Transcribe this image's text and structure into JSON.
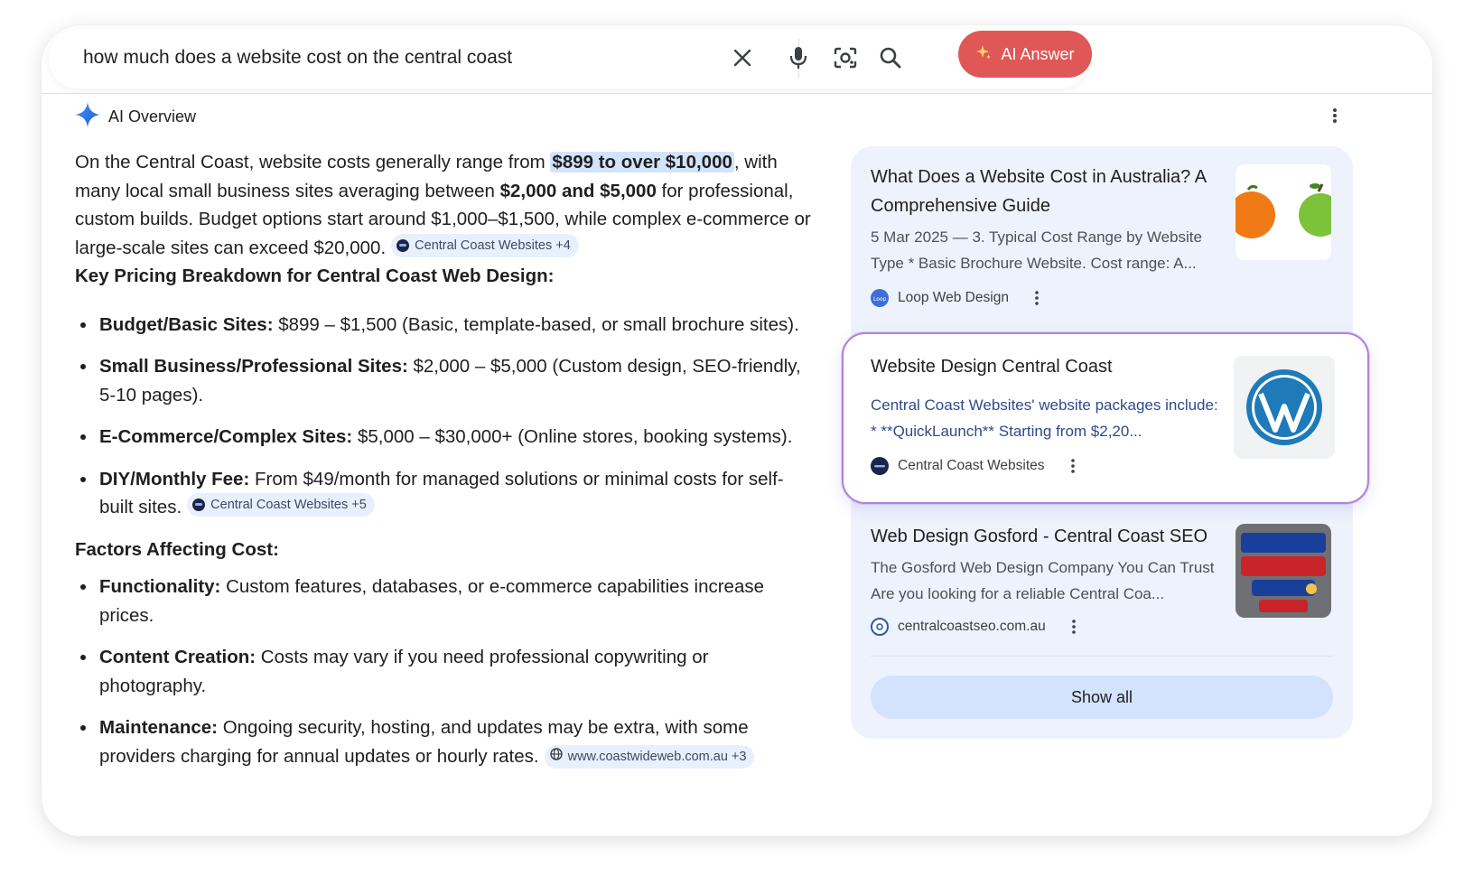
{
  "search": {
    "query": "how much does a website cost on the central coast",
    "ai_button_label": "AI Answer"
  },
  "overview": {
    "title": "AI Overview",
    "intro_pre": "On the Central Coast, website costs generally range from ",
    "intro_highlight": "$899 to over $10,000",
    "intro_mid": ", with many local small business sites averaging between ",
    "intro_bold": "$2,000 and $5,000",
    "intro_post": " for professional, custom builds. Budget options start around $1,000–$1,500, while complex e-commerce or large-scale sites can exceed $20,000.",
    "intro_chip": "Central Coast Websites +4",
    "pricing_heading": "Key Pricing Breakdown for Central Coast Web Design:",
    "pricing": [
      {
        "label": "Budget/Basic Sites:",
        "text": " $899 – $1,500 (Basic, template-based, or small brochure sites)."
      },
      {
        "label": "Small Business/Professional Sites:",
        "text": " $2,000 – $5,000 (Custom design, SEO-friendly, 5-10 pages)."
      },
      {
        "label": "E-Commerce/Complex Sites:",
        "text": " $5,000 – $30,000+ (Online stores, booking systems)."
      },
      {
        "label": "DIY/Monthly Fee:",
        "text": " From $49/month for managed solutions or minimal costs for self-built sites.",
        "chip": "Central Coast Websites +5"
      }
    ],
    "factors_heading": "Factors Affecting Cost:",
    "factors": [
      {
        "label": "Functionality:",
        "text": " Custom features, databases, or e-commerce capabilities increase prices."
      },
      {
        "label": "Content Creation:",
        "text": " Costs may vary if you need professional copywriting or photography."
      },
      {
        "label": "Maintenance:",
        "text": " Ongoing security, hosting, and updates may be extra, with some providers charging for annual updates or hourly rates.",
        "chip": "www.coastwideweb.com.au +3"
      }
    ]
  },
  "sources": [
    {
      "title": "What Does a Website Cost in Australia? A Comprehensive Guide",
      "snippet": "5 Mar 2025 — 3. Typical Cost Range by Website Type * Basic Brochure Website. Cost range: A...",
      "site": "Loop Web Design",
      "thumb": "oranges-apple-image"
    },
    {
      "title": "Website Design Central Coast",
      "snippet": "Central Coast Websites' website packages include: * **QuickLaunch** Starting from $2,20...",
      "site": "Central Coast Websites",
      "thumb": "wordpress-logo"
    },
    {
      "title": "Web Design Gosford - Central Coast SEO",
      "snippet": "The Gosford Web Design Company You Can Trust Are you looking for a reliable Central Coa...",
      "site": "centralcoastseo.com.au",
      "thumb": "get-an-instant-quote-image"
    }
  ],
  "show_all_label": "Show all",
  "colors": {
    "ai_button": "#e05757",
    "highlight": "#d3e3fd",
    "panel": "#eef2fc",
    "card_border": "#b47fe0"
  }
}
